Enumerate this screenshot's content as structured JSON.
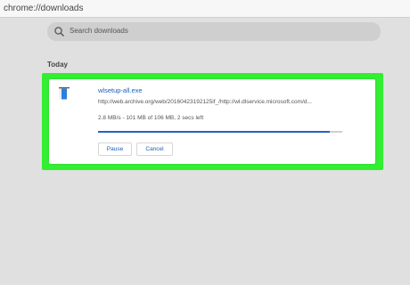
{
  "address_bar": {
    "url": "chrome://downloads"
  },
  "search": {
    "placeholder": "Search downloads",
    "icon": "search-icon"
  },
  "date_header": "Today",
  "download": {
    "filename": "wlsetup-all.exe",
    "url": "http://web.archive.org/web/20160423192125if_/http://wl.dlservice.microsoft.com/d...",
    "status": "2.8 MB/s - 101 MB of 106 MB, 2 secs left",
    "progress": 0.95,
    "pause_label": "Pause",
    "cancel_label": "Cancel",
    "icon": "file-icon"
  },
  "colors": {
    "highlight": "#33ee33",
    "link": "#1a5fc0",
    "progress": "#2563c4",
    "background": "#e0e0e0"
  }
}
